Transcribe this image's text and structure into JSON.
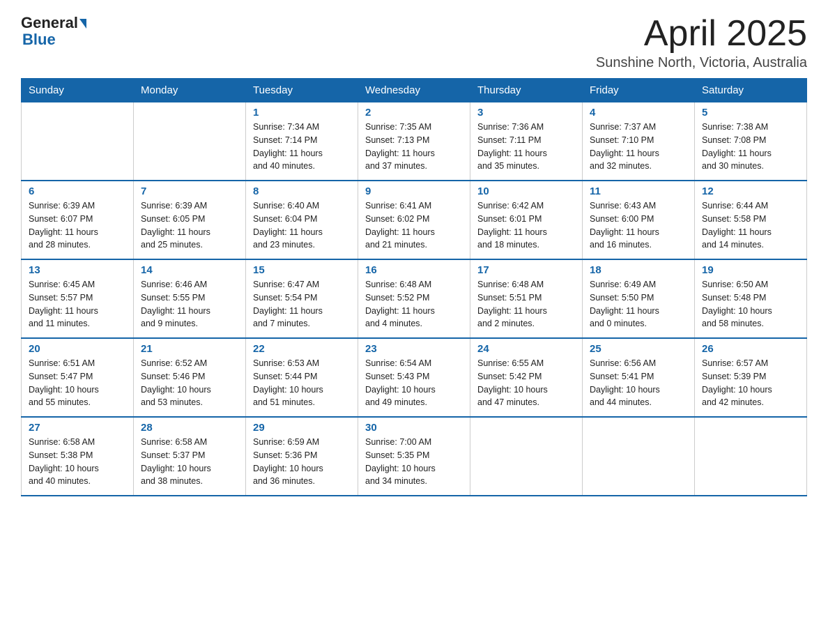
{
  "header": {
    "logo": {
      "general": "General",
      "blue": "Blue"
    },
    "title": "April 2025",
    "subtitle": "Sunshine North, Victoria, Australia"
  },
  "weekdays": [
    "Sunday",
    "Monday",
    "Tuesday",
    "Wednesday",
    "Thursday",
    "Friday",
    "Saturday"
  ],
  "weeks": [
    [
      {
        "day": "",
        "info": ""
      },
      {
        "day": "",
        "info": ""
      },
      {
        "day": "1",
        "info": "Sunrise: 7:34 AM\nSunset: 7:14 PM\nDaylight: 11 hours\nand 40 minutes."
      },
      {
        "day": "2",
        "info": "Sunrise: 7:35 AM\nSunset: 7:13 PM\nDaylight: 11 hours\nand 37 minutes."
      },
      {
        "day": "3",
        "info": "Sunrise: 7:36 AM\nSunset: 7:11 PM\nDaylight: 11 hours\nand 35 minutes."
      },
      {
        "day": "4",
        "info": "Sunrise: 7:37 AM\nSunset: 7:10 PM\nDaylight: 11 hours\nand 32 minutes."
      },
      {
        "day": "5",
        "info": "Sunrise: 7:38 AM\nSunset: 7:08 PM\nDaylight: 11 hours\nand 30 minutes."
      }
    ],
    [
      {
        "day": "6",
        "info": "Sunrise: 6:39 AM\nSunset: 6:07 PM\nDaylight: 11 hours\nand 28 minutes."
      },
      {
        "day": "7",
        "info": "Sunrise: 6:39 AM\nSunset: 6:05 PM\nDaylight: 11 hours\nand 25 minutes."
      },
      {
        "day": "8",
        "info": "Sunrise: 6:40 AM\nSunset: 6:04 PM\nDaylight: 11 hours\nand 23 minutes."
      },
      {
        "day": "9",
        "info": "Sunrise: 6:41 AM\nSunset: 6:02 PM\nDaylight: 11 hours\nand 21 minutes."
      },
      {
        "day": "10",
        "info": "Sunrise: 6:42 AM\nSunset: 6:01 PM\nDaylight: 11 hours\nand 18 minutes."
      },
      {
        "day": "11",
        "info": "Sunrise: 6:43 AM\nSunset: 6:00 PM\nDaylight: 11 hours\nand 16 minutes."
      },
      {
        "day": "12",
        "info": "Sunrise: 6:44 AM\nSunset: 5:58 PM\nDaylight: 11 hours\nand 14 minutes."
      }
    ],
    [
      {
        "day": "13",
        "info": "Sunrise: 6:45 AM\nSunset: 5:57 PM\nDaylight: 11 hours\nand 11 minutes."
      },
      {
        "day": "14",
        "info": "Sunrise: 6:46 AM\nSunset: 5:55 PM\nDaylight: 11 hours\nand 9 minutes."
      },
      {
        "day": "15",
        "info": "Sunrise: 6:47 AM\nSunset: 5:54 PM\nDaylight: 11 hours\nand 7 minutes."
      },
      {
        "day": "16",
        "info": "Sunrise: 6:48 AM\nSunset: 5:52 PM\nDaylight: 11 hours\nand 4 minutes."
      },
      {
        "day": "17",
        "info": "Sunrise: 6:48 AM\nSunset: 5:51 PM\nDaylight: 11 hours\nand 2 minutes."
      },
      {
        "day": "18",
        "info": "Sunrise: 6:49 AM\nSunset: 5:50 PM\nDaylight: 11 hours\nand 0 minutes."
      },
      {
        "day": "19",
        "info": "Sunrise: 6:50 AM\nSunset: 5:48 PM\nDaylight: 10 hours\nand 58 minutes."
      }
    ],
    [
      {
        "day": "20",
        "info": "Sunrise: 6:51 AM\nSunset: 5:47 PM\nDaylight: 10 hours\nand 55 minutes."
      },
      {
        "day": "21",
        "info": "Sunrise: 6:52 AM\nSunset: 5:46 PM\nDaylight: 10 hours\nand 53 minutes."
      },
      {
        "day": "22",
        "info": "Sunrise: 6:53 AM\nSunset: 5:44 PM\nDaylight: 10 hours\nand 51 minutes."
      },
      {
        "day": "23",
        "info": "Sunrise: 6:54 AM\nSunset: 5:43 PM\nDaylight: 10 hours\nand 49 minutes."
      },
      {
        "day": "24",
        "info": "Sunrise: 6:55 AM\nSunset: 5:42 PM\nDaylight: 10 hours\nand 47 minutes."
      },
      {
        "day": "25",
        "info": "Sunrise: 6:56 AM\nSunset: 5:41 PM\nDaylight: 10 hours\nand 44 minutes."
      },
      {
        "day": "26",
        "info": "Sunrise: 6:57 AM\nSunset: 5:39 PM\nDaylight: 10 hours\nand 42 minutes."
      }
    ],
    [
      {
        "day": "27",
        "info": "Sunrise: 6:58 AM\nSunset: 5:38 PM\nDaylight: 10 hours\nand 40 minutes."
      },
      {
        "day": "28",
        "info": "Sunrise: 6:58 AM\nSunset: 5:37 PM\nDaylight: 10 hours\nand 38 minutes."
      },
      {
        "day": "29",
        "info": "Sunrise: 6:59 AM\nSunset: 5:36 PM\nDaylight: 10 hours\nand 36 minutes."
      },
      {
        "day": "30",
        "info": "Sunrise: 7:00 AM\nSunset: 5:35 PM\nDaylight: 10 hours\nand 34 minutes."
      },
      {
        "day": "",
        "info": ""
      },
      {
        "day": "",
        "info": ""
      },
      {
        "day": "",
        "info": ""
      }
    ]
  ]
}
